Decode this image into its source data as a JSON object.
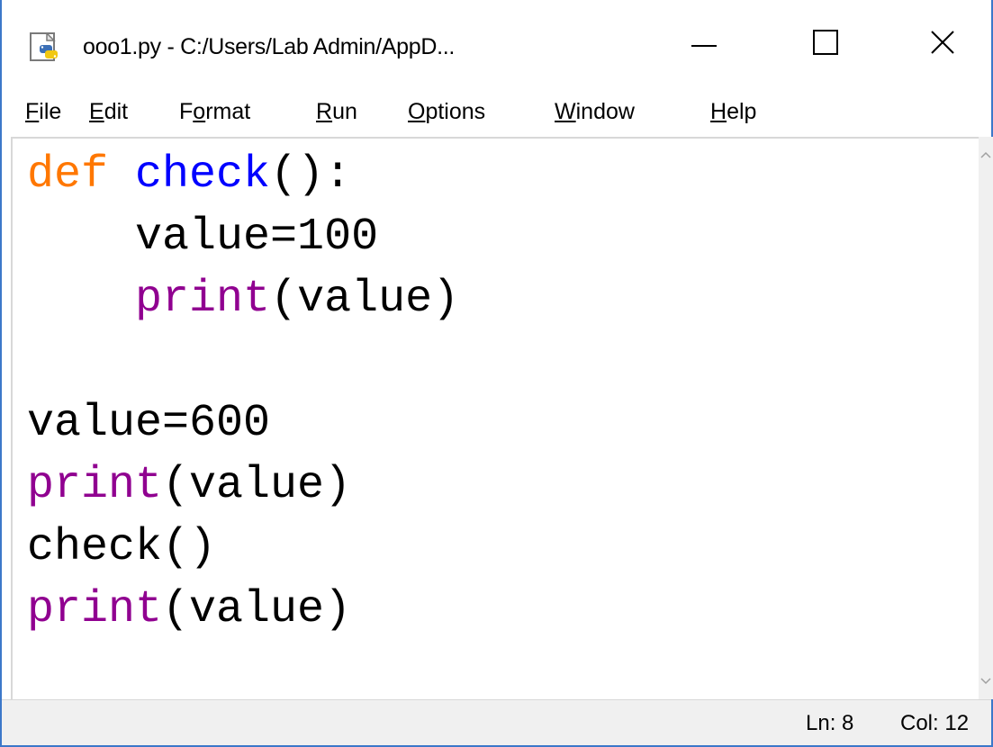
{
  "window": {
    "title": "ooo1.py - C:/Users/Lab Admin/AppD...",
    "app_icon": "python-file-icon",
    "controls": {
      "minimize_icon": "minimize-icon",
      "maximize_icon": "maximize-icon",
      "close_icon": "close-icon"
    }
  },
  "menu": {
    "items": [
      {
        "mnemonic": "F",
        "rest": "ile"
      },
      {
        "mnemonic": "E",
        "rest": "dit"
      },
      {
        "pre": "F",
        "mnemonic": "o",
        "rest": "rmat"
      },
      {
        "mnemonic": "R",
        "rest": "un"
      },
      {
        "mnemonic": "O",
        "rest": "ptions"
      },
      {
        "mnemonic": "W",
        "rest": "indow"
      },
      {
        "mnemonic": "H",
        "rest": "elp"
      }
    ]
  },
  "editor": {
    "lines": [
      {
        "t1": "def",
        "t2": " ",
        "t3": "check",
        "t4": "():"
      },
      {
        "indent": "    ",
        "t1": "value=100"
      },
      {
        "indent": "    ",
        "t1": "print",
        "t2": "(value)"
      },
      {
        "t1": ""
      },
      {
        "t1": "value=600"
      },
      {
        "t1": "print",
        "t2": "(value)"
      },
      {
        "t1": "check()"
      },
      {
        "t1": "print",
        "t2": "(value)"
      }
    ],
    "colors": {
      "keyword": "#ff7700",
      "definition": "#0000ff",
      "builtin": "#900090",
      "text": "#000000"
    }
  },
  "status": {
    "line": "Ln: 8",
    "column": "Col: 12"
  }
}
